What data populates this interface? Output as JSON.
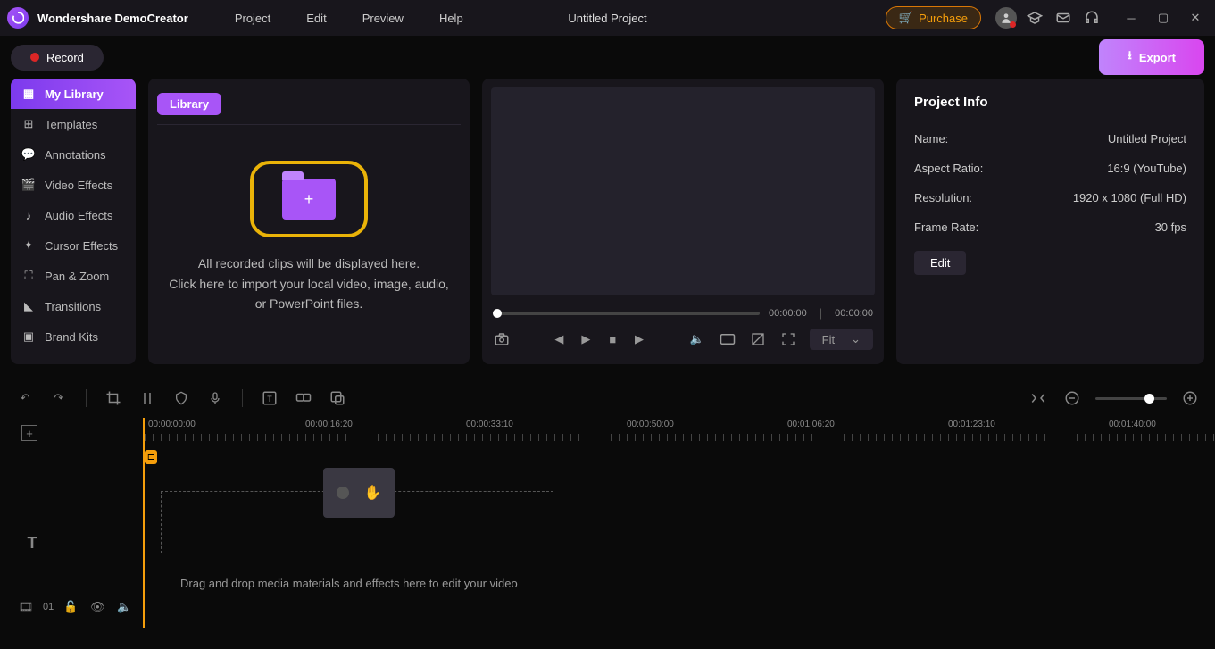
{
  "header": {
    "app_name": "Wondershare DemoCreator",
    "menu": [
      "Project",
      "Edit",
      "Preview",
      "Help"
    ],
    "project_title": "Untitled Project",
    "purchase_label": "Purchase"
  },
  "row2": {
    "record_label": "Record",
    "export_label": "Export"
  },
  "sidebar": {
    "items": [
      {
        "label": "My Library"
      },
      {
        "label": "Templates"
      },
      {
        "label": "Annotations"
      },
      {
        "label": "Video Effects"
      },
      {
        "label": "Audio Effects"
      },
      {
        "label": "Cursor Effects"
      },
      {
        "label": "Pan & Zoom"
      },
      {
        "label": "Transitions"
      },
      {
        "label": "Brand Kits"
      }
    ]
  },
  "library": {
    "tab_label": "Library",
    "import_line1": "All recorded clips will be displayed here.",
    "import_line2": "Click here to import your local video, image, audio,",
    "import_line3": "or PowerPoint files."
  },
  "preview": {
    "time_current": "00:00:00",
    "time_total": "00:00:00",
    "fit_label": "Fit"
  },
  "info": {
    "title": "Project Info",
    "name_label": "Name:",
    "name_value": "Untitled Project",
    "aspect_label": "Aspect Ratio:",
    "aspect_value": "16:9 (YouTube)",
    "resolution_label": "Resolution:",
    "resolution_value": "1920 x 1080 (Full HD)",
    "framerate_label": "Frame Rate:",
    "framerate_value": "30 fps",
    "edit_label": "Edit"
  },
  "timeline": {
    "track_count": "01",
    "ruler": [
      "00:00:00:00",
      "00:00:16:20",
      "00:00:33:10",
      "00:00:50:00",
      "00:01:06:20",
      "00:01:23:10",
      "00:01:40:00"
    ],
    "playhead_symbol": "⊏",
    "drop_text": "Drag and drop media materials and effects here to edit your video"
  }
}
